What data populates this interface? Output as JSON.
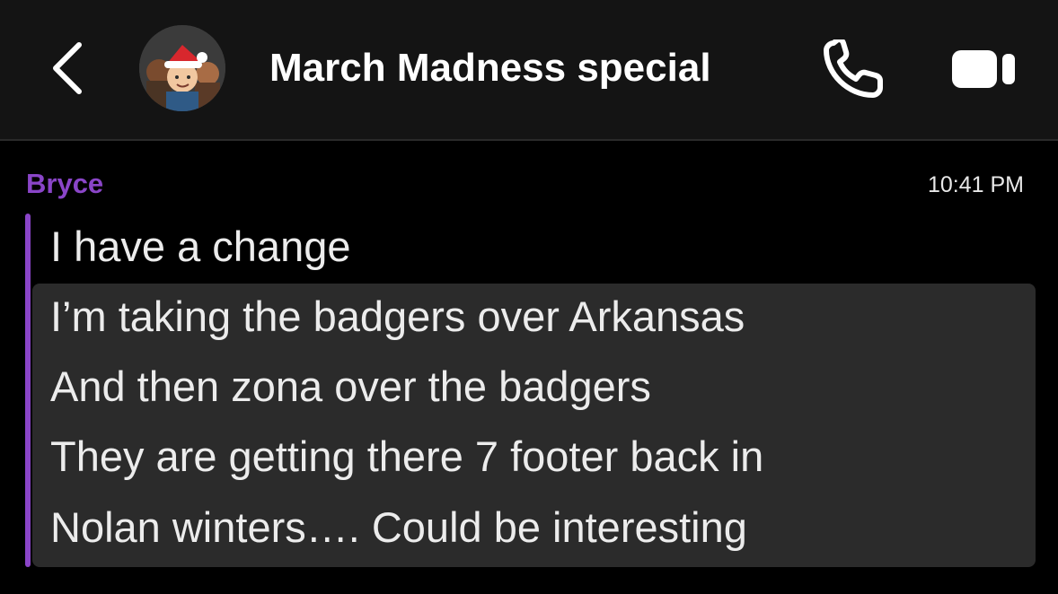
{
  "header": {
    "title": "March Madness special",
    "back_icon": "chevron-left-icon",
    "call_icon": "phone-icon",
    "video_icon": "video-camera-icon",
    "avatar_icon": "group-bitmoji-avatar"
  },
  "message": {
    "sender": "Bryce",
    "time": "10:41 PM",
    "accent_color": "#8a45c8",
    "lines": [
      "I have a change",
      "I’m taking the badgers over Arkansas",
      "And then zona over the badgers",
      "They are getting there 7 footer back in",
      "Nolan winters…. Could be interesting"
    ]
  }
}
